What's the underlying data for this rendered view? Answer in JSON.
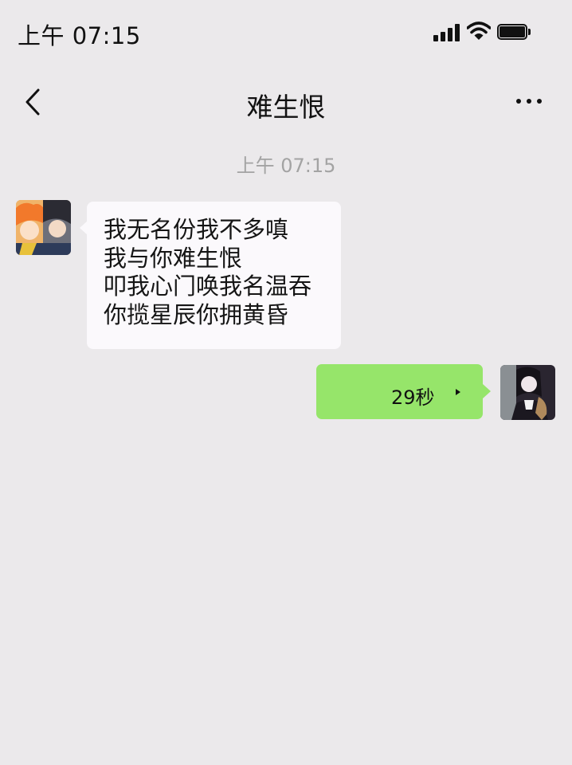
{
  "status_bar": {
    "time": "上午 07:15",
    "signal_icon": "signal-icon",
    "wifi_icon": "wifi-icon",
    "battery_icon": "battery-icon"
  },
  "nav": {
    "back_icon": "chevron-left-icon",
    "title": "难生恨",
    "more_icon": "more-horizontal-icon"
  },
  "chat": {
    "timestamp": "上午 07:15",
    "messages": [
      {
        "direction": "incoming",
        "type": "text",
        "lines": [
          "我无名份我不多嗔",
          "我与你难生恨",
          "叩我心门唤我名温吞",
          "你揽星辰你拥黄昏"
        ]
      },
      {
        "direction": "outgoing",
        "type": "voice",
        "duration": "29秒",
        "icon": "voice-play-icon"
      }
    ]
  },
  "colors": {
    "background": "#ebe9eb",
    "incoming_bubble": "#fbf9fc",
    "outgoing_bubble": "#96e56a",
    "timestamp_text": "#a3a3a3"
  }
}
